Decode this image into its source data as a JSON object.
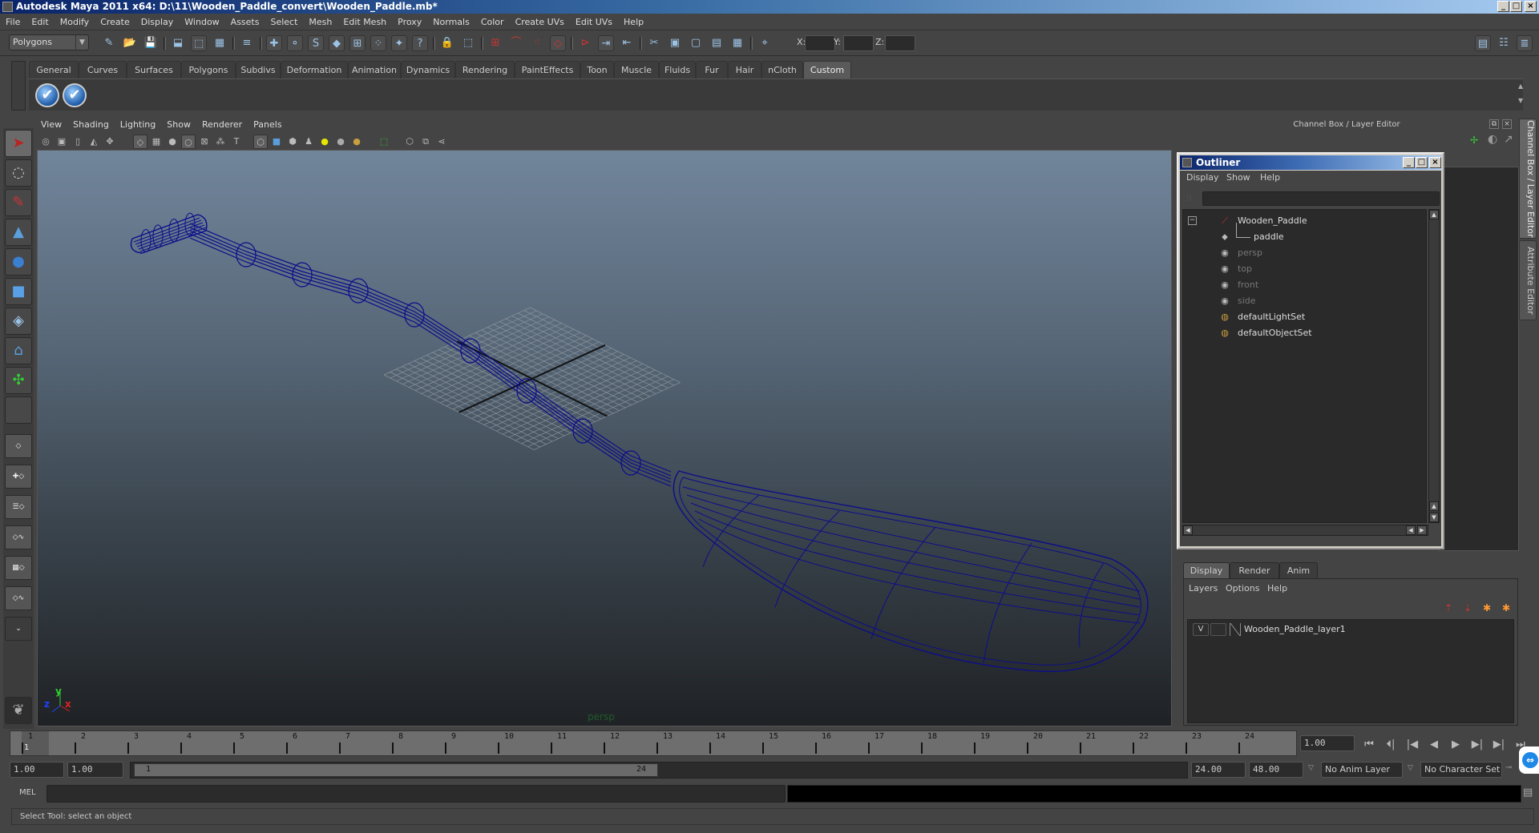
{
  "window": {
    "title": "Autodesk Maya 2011 x64: D:\\11\\Wooden_Paddle_convert\\Wooden_Paddle.mb*",
    "minimize_glyph": "_",
    "maximize_glyph": "□",
    "close_glyph": "×"
  },
  "menubar": [
    "File",
    "Edit",
    "Modify",
    "Create",
    "Display",
    "Window",
    "Assets",
    "Select",
    "Mesh",
    "Edit Mesh",
    "Proxy",
    "Normals",
    "Color",
    "Create UVs",
    "Edit UVs",
    "Help"
  ],
  "statusline": {
    "mode": "Polygons",
    "x_label": "X:",
    "y_label": "Y:",
    "z_label": "Z:",
    "icons": [
      "new-scene",
      "open-scene",
      "save-scene",
      "select-by-hierarchy",
      "select-by-object-type",
      "select-by-component-type",
      "mask-menu",
      "select-handles",
      "select-joints",
      "select-curves",
      "select-surfaces",
      "select-deformations",
      "select-dynamics",
      "select-rendering",
      "select-misc",
      "lock-selection",
      "highlight-selection",
      "snap-to-grids",
      "snap-to-curves",
      "snap-to-points",
      "snap-to-view-planes",
      "make-live",
      "input-ops",
      "output-ops",
      "construction-history",
      "render-current-frame",
      "ipr-render",
      "render-settings",
      "hypershade",
      "input-line-menu"
    ],
    "right_icons": [
      "show-hide-attribute-editor",
      "show-hide-tool-settings",
      "show-hide-channel-box"
    ]
  },
  "shelf": {
    "tabs": [
      "General",
      "Curves",
      "Surfaces",
      "Polygons",
      "Subdivs",
      "Deformation",
      "Animation",
      "Dynamics",
      "Rendering",
      "PaintEffects",
      "Toon",
      "Muscle",
      "Fluids",
      "Fur",
      "Hair",
      "nCloth",
      "Custom"
    ],
    "active_tab": "Custom",
    "buttons": [
      {
        "icon": "checkmark-icon",
        "glyph": "✔"
      },
      {
        "icon": "checkmark-icon",
        "glyph": "✔"
      }
    ]
  },
  "toolbox": {
    "tools": [
      {
        "name": "select-tool",
        "glyph": "➤",
        "active": true
      },
      {
        "name": "lasso-tool",
        "glyph": "◌"
      },
      {
        "name": "paint-select-tool",
        "glyph": "✎"
      },
      {
        "name": "move-tool",
        "glyph": "▲"
      },
      {
        "name": "rotate-tool",
        "glyph": "●"
      },
      {
        "name": "scale-tool",
        "glyph": "■"
      },
      {
        "name": "universal-manipulator",
        "glyph": "◈"
      },
      {
        "name": "soft-modification-tool",
        "glyph": "⌂"
      },
      {
        "name": "show-manipulator-tool",
        "glyph": "✣"
      },
      {
        "name": "last-tool-used",
        "glyph": ""
      }
    ],
    "layouts": [
      "single-perspective-view",
      "four-view",
      "persp-outliner",
      "persp-graph",
      "hypershade-persp",
      "persp-graph-hypergraph",
      "more-layouts"
    ]
  },
  "viewport": {
    "menu": [
      "View",
      "Shading",
      "Lighting",
      "Show",
      "Renderer",
      "Panels"
    ],
    "camera": "persp",
    "axis": {
      "x": "x",
      "y": "y",
      "z": "z"
    },
    "wire_color": "#0d0d8a",
    "colors": {
      "x": "#e02020",
      "y": "#2fd02f",
      "z": "#2040ff"
    }
  },
  "dock": {
    "title": "Channel Box / Layer Editor",
    "side_tabs": [
      "Channel Box / Layer Editor",
      "Attribute Editor"
    ]
  },
  "outliner": {
    "title": "Outliner",
    "menu": [
      "Display",
      "Show",
      "Help"
    ],
    "filter": "",
    "items": [
      {
        "label": "Wooden_Paddle",
        "icon": "transform-icon",
        "glyph": "⟋",
        "style": "bright",
        "expanded": true
      },
      {
        "label": "paddle",
        "icon": "mesh-icon",
        "glyph": "⬥",
        "style": "bright",
        "child": true
      },
      {
        "label": "persp",
        "icon": "camera-icon",
        "glyph": "◉",
        "style": "dim"
      },
      {
        "label": "top",
        "icon": "camera-icon",
        "glyph": "◉",
        "style": "dim"
      },
      {
        "label": "front",
        "icon": "camera-icon",
        "glyph": "◉",
        "style": "dim"
      },
      {
        "label": "side",
        "icon": "camera-icon",
        "glyph": "◉",
        "style": "dim"
      },
      {
        "label": "defaultLightSet",
        "icon": "set-icon",
        "glyph": "◍",
        "style": "bright"
      },
      {
        "label": "defaultObjectSet",
        "icon": "set-icon",
        "glyph": "◍",
        "style": "bright"
      }
    ]
  },
  "layer_editor": {
    "tabs": [
      "Display",
      "Render",
      "Anim"
    ],
    "active_tab": "Display",
    "menu": [
      "Layers",
      "Options",
      "Help"
    ],
    "layers": [
      {
        "visible": "V",
        "playback": "",
        "name": "Wooden_Paddle_layer1"
      }
    ]
  },
  "timeline": {
    "ticks": [
      "1",
      "2",
      "3",
      "4",
      "5",
      "6",
      "7",
      "8",
      "9",
      "10",
      "11",
      "12",
      "13",
      "14",
      "15",
      "16",
      "17",
      "18",
      "19",
      "20",
      "21",
      "22",
      "23",
      "24"
    ],
    "current_frame": "1",
    "current_time": "1.00",
    "playback_buttons": [
      {
        "name": "go-to-start",
        "glyph": "⏮"
      },
      {
        "name": "step-back-frame",
        "glyph": "⏴|"
      },
      {
        "name": "step-back-key",
        "glyph": "|◀"
      },
      {
        "name": "play-backwards",
        "glyph": "◀"
      },
      {
        "name": "play-forwards",
        "glyph": "▶"
      },
      {
        "name": "step-forward-key",
        "glyph": "▶|"
      },
      {
        "name": "step-forward-frame",
        "glyph": "▶|"
      },
      {
        "name": "go-to-end",
        "glyph": "⏭"
      }
    ]
  },
  "range": {
    "start_time": "1.00",
    "playback_start": "1.00",
    "range_start": "1",
    "range_end": "24",
    "playback_end": "24.00",
    "end_time": "48.00",
    "anim_layer": "No Anim Layer",
    "character_set": "No Character Set"
  },
  "commandline": {
    "label": "MEL",
    "input": "",
    "output": ""
  },
  "helpline": "Select Tool: select an object"
}
